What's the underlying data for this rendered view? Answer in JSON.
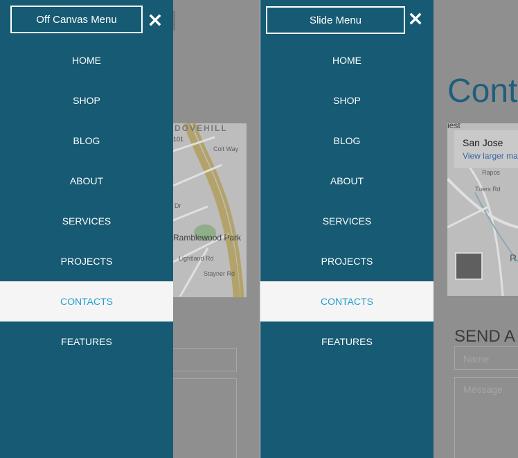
{
  "left_panel": {
    "menu_title": "Off Canvas Menu",
    "close_icon": "close-icon",
    "menu_items": [
      {
        "label": "HOME"
      },
      {
        "label": "SHOP"
      },
      {
        "label": "BLOG"
      },
      {
        "label": "ABOUT"
      },
      {
        "label": "SERVICES"
      },
      {
        "label": "PROJECTS"
      },
      {
        "label": "CONTACTS",
        "active": true
      },
      {
        "label": "FEATURES"
      }
    ],
    "page": {
      "map_labels": {
        "top": "DOVEHILL",
        "park": "Ramblewood Park",
        "highway": "101",
        "street_1": "Colt Way",
        "street_2": "Lightland Rd",
        "street_3": "Stayner Rd",
        "street_4": "Dr"
      }
    }
  },
  "right_panel": {
    "menu_title": "Slide Menu",
    "close_icon": "close-icon",
    "menu_items": [
      {
        "label": "HOME"
      },
      {
        "label": "SHOP"
      },
      {
        "label": "BLOG"
      },
      {
        "label": "ABOUT"
      },
      {
        "label": "SERVICES"
      },
      {
        "label": "PROJECTS"
      },
      {
        "label": "CONTACTS",
        "active": true
      },
      {
        "label": "FEATURES"
      }
    ],
    "page": {
      "heading": "Cont",
      "map_card_title": "San Jose",
      "map_card_link": "View larger ma",
      "map_fragment": "iest",
      "map_label_1": "Tuers Rd",
      "map_label_2": "Rapos",
      "map_label_3": "R",
      "send_heading": "SEND A",
      "name_placeholder": "Name",
      "message_placeholder": "Message"
    }
  },
  "colors": {
    "drawer_background": "#165a73",
    "active_item_background": "#f5f5f5",
    "active_item_text": "#239fce",
    "item_text": "#ffffff"
  }
}
